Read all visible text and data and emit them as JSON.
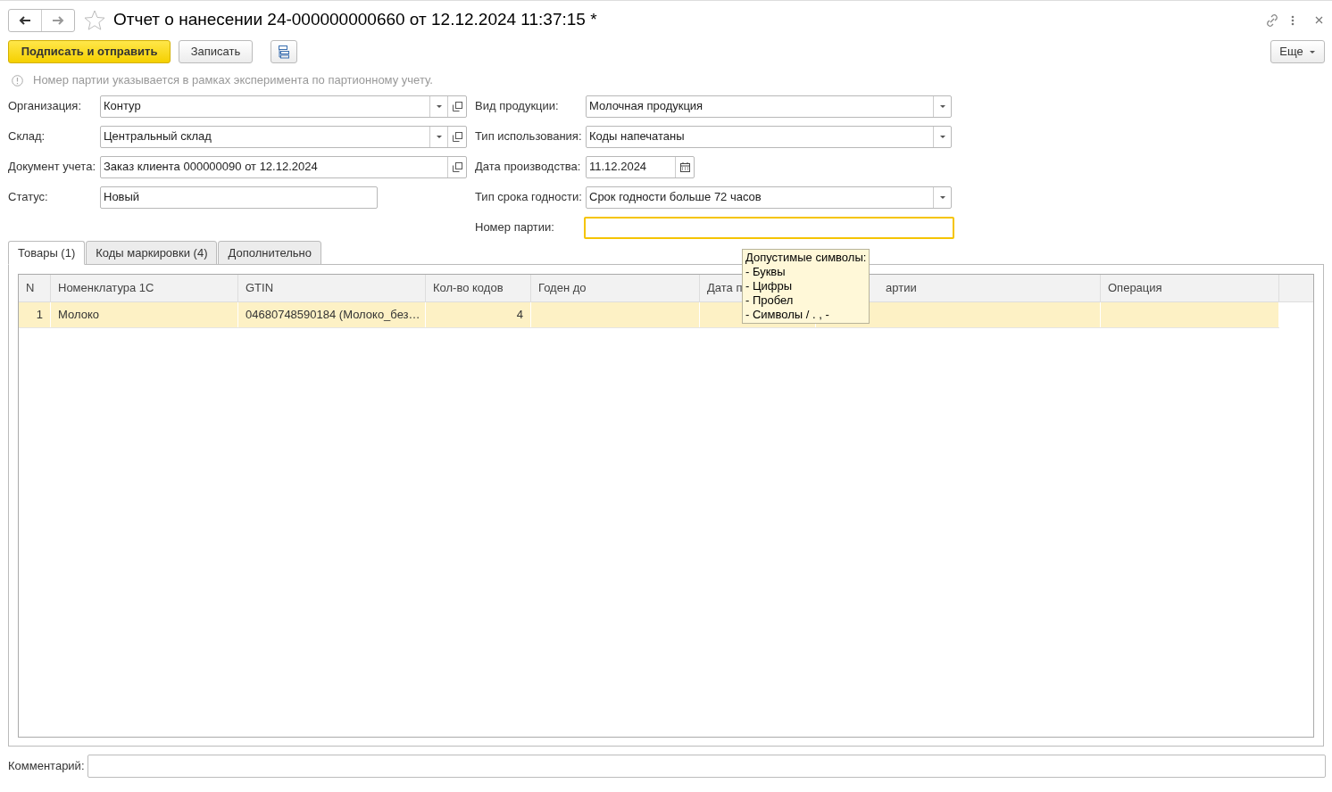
{
  "window": {
    "title": "Отчет о нанесении 24-000000000660 от 12.12.2024 11:37:15 *",
    "favorite": false
  },
  "toolbar": {
    "primary": "Подписать и отправить",
    "save": "Записать",
    "more": "Еще"
  },
  "info": "Номер партии указывается в рамках эксперимента по партионному учету.",
  "left_fields": [
    {
      "label": "Организация:",
      "value": "Контур",
      "kind": "select_open"
    },
    {
      "label": "Склад:",
      "value": "Центральный склад",
      "kind": "select_open"
    },
    {
      "label": "Документ учета:",
      "value": "Заказ клиента 000000090 от 12.12.2024",
      "kind": "open"
    },
    {
      "label": "Статус:",
      "value": "Новый",
      "kind": "short"
    }
  ],
  "right_fields": [
    {
      "label": "Вид продукции:",
      "value": "Молочная продукция",
      "kind": "select",
      "focused": false
    },
    {
      "label": "Тип использования:",
      "value": "Коды напечатаны",
      "kind": "select",
      "focused": false
    },
    {
      "label": "Дата производства:",
      "value": "11.12.2024",
      "kind": "date",
      "focused": false
    },
    {
      "label": "Тип срока годности:",
      "value": "Срок годности больше 72 часов",
      "kind": "select",
      "focused": false
    },
    {
      "label": "Номер партии:",
      "kind": "text",
      "focused": true
    }
  ],
  "tooltip": {
    "title": "Допустимые символы:",
    "lines": [
      "- Буквы",
      "- Цифры",
      "- Пробел",
      "- Символы / . , -"
    ]
  },
  "tabs": [
    {
      "label": "Товары (1)",
      "selected": true
    },
    {
      "label": "Коды маркировки (4)",
      "selected": false
    },
    {
      "label": "Дополнительно",
      "selected": false
    }
  ],
  "table": {
    "columns": [
      "N",
      "Номенклатура 1С",
      "GTIN",
      "Кол-во кодов",
      "Годен до",
      "Дата п",
      "артии",
      "Операция"
    ],
    "rows": [
      {
        "selected": true,
        "cells": [
          "1",
          "Молоко",
          "04680748590184 (Молоко_без…",
          "4",
          "",
          "",
          "",
          ""
        ]
      }
    ]
  },
  "comment": {
    "label": "Комментарий:"
  }
}
